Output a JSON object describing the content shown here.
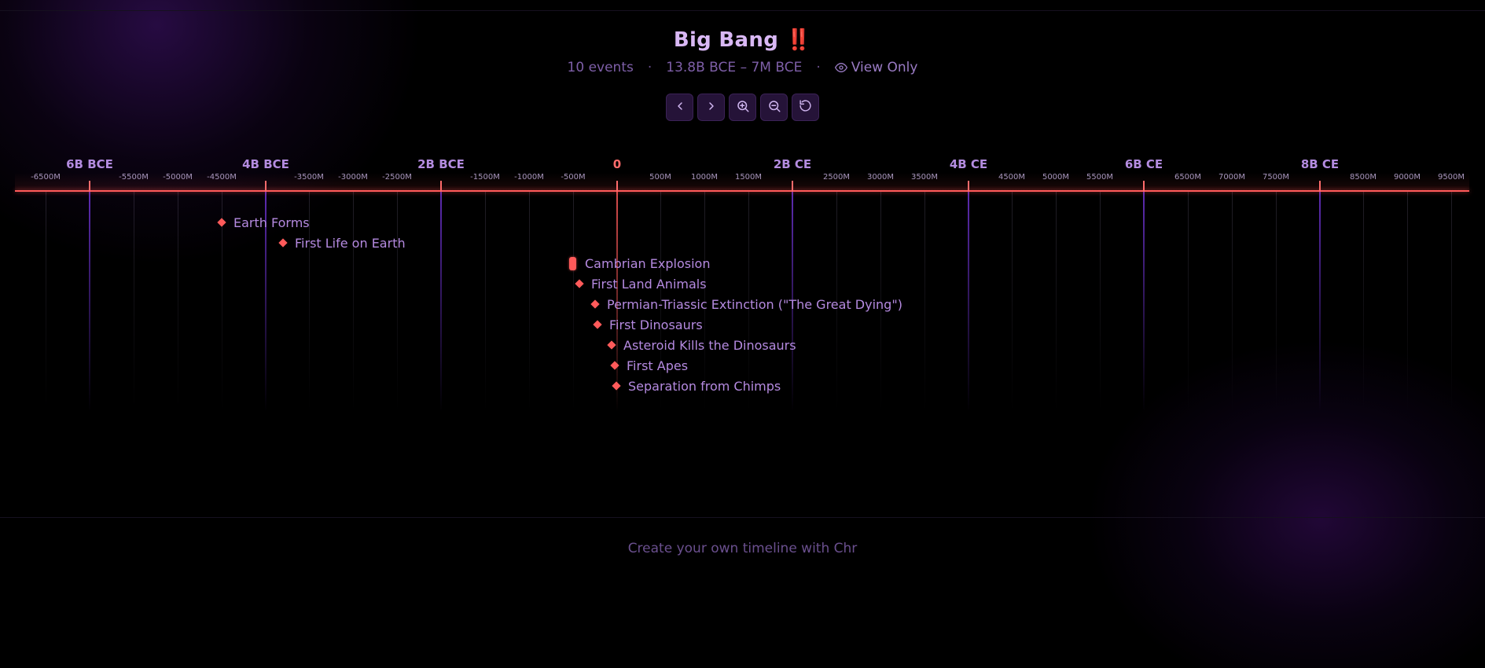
{
  "header": {
    "title": "Big Bang ‼️",
    "event_count": "10 events",
    "range": "13.8B BCE – 7M BCE",
    "mode": "View Only"
  },
  "controls": [
    {
      "name": "prev-button",
      "icon": "chevron-left-icon"
    },
    {
      "name": "next-button",
      "icon": "chevron-right-icon"
    },
    {
      "name": "zoom-in-button",
      "icon": "zoom-in-icon"
    },
    {
      "name": "zoom-out-button",
      "icon": "zoom-out-icon"
    },
    {
      "name": "reset-view-button",
      "icon": "rotate-ccw-icon"
    }
  ],
  "axis": {
    "major_labels": [
      "6B BCE",
      "4B BCE",
      "2B BCE",
      "0",
      "2B CE",
      "4B CE",
      "6B CE",
      "8B CE"
    ],
    "minor_labels": [
      "-6500M",
      "-5500M",
      "-5000M",
      "-4500M",
      "-3500M",
      "-3000M",
      "-2500M",
      "-1500M",
      "-1000M",
      "-500M",
      "500M",
      "1000M",
      "1500M",
      "2500M",
      "3000M",
      "3500M",
      "4500M",
      "5000M",
      "5500M",
      "6500M",
      "7000M",
      "7500M",
      "8500M",
      "9000M",
      "9500M"
    ]
  },
  "events": [
    {
      "label": "Earth Forms",
      "marker": "diamond"
    },
    {
      "label": "First Life on Earth",
      "marker": "diamond"
    },
    {
      "label": "Cambrian Explosion",
      "marker": "range"
    },
    {
      "label": "First Land Animals",
      "marker": "diamond"
    },
    {
      "label": "Permian-Triassic Extinction (\"The Great Dying\")",
      "marker": "diamond"
    },
    {
      "label": "First Dinosaurs",
      "marker": "diamond"
    },
    {
      "label": "Asteroid Kills the Dinosaurs",
      "marker": "diamond"
    },
    {
      "label": "First Apes",
      "marker": "diamond"
    },
    {
      "label": "Separation from Chimps",
      "marker": "diamond"
    }
  ],
  "footer": {
    "text": "Create your own timeline with Chr"
  },
  "colors": {
    "accent": "#ff5a5a",
    "title": "#d9b8f5",
    "grid_major": "#7c3aed"
  }
}
